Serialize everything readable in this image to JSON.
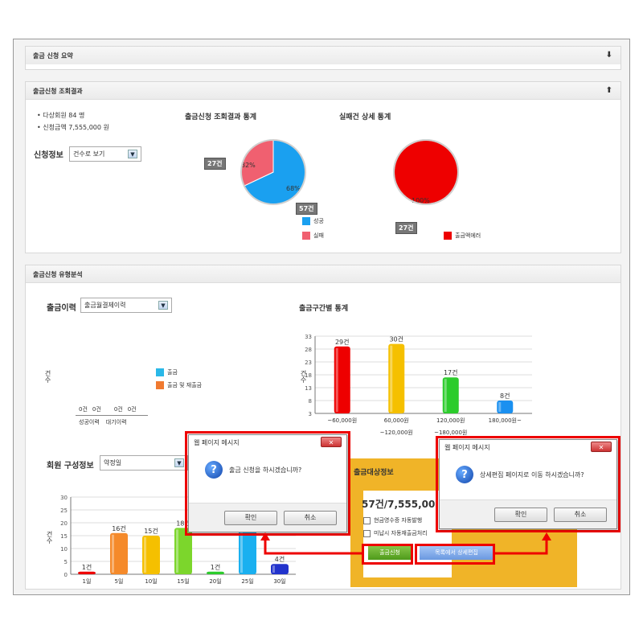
{
  "panel1": {
    "title": "출금 신청 요약",
    "toggle": "⬇"
  },
  "panel2": {
    "title": "출금신청 조회결과",
    "toggle": "⬆",
    "bullets": [
      "다상회원 84 명",
      "신청금액 7,555,000 원"
    ],
    "info_label": "신청정보",
    "info_select": "건수로 보기",
    "chart1_title": "출금신청 조회결과 통계",
    "chart2_title": "실패건 상세 통계"
  },
  "panel3": {
    "title": "출금신청 유형분석",
    "history_label": "출금이력",
    "history_select": "출금월결제이력",
    "yaxis_label": "건수",
    "legend_a": "출금",
    "legend_b": "출금 및 재출금",
    "small_values": [
      "0건",
      "0건",
      "0건",
      "0건"
    ],
    "small_cats": [
      "성공이력",
      "대기이력"
    ],
    "range_title": "출금구간별 통계",
    "member_label": "회원 구성정보",
    "member_select": "약정일",
    "target_title": "출금대상정보",
    "target_amount": "57건/7,555,00",
    "check1": "현금영수증 자동발행",
    "check2": "미납시 자동재출금처리",
    "btn_apply": "출금신청",
    "btn_edit": "목록에서 상세편집"
  },
  "dialog1": {
    "title": "웹 페이지 메시지",
    "close": "✕",
    "icon": "?",
    "message": "출금 신청을 하시겠습니까?",
    "ok": "확인",
    "cancel": "취소"
  },
  "dialog2": {
    "title": "웹 페이지 메시지",
    "close": "✕",
    "icon": "?",
    "message": "상세편집 페이지로 이동 하시겠습니까?",
    "ok": "확인",
    "cancel": "취소"
  },
  "colors": {
    "success": "#1aa0f0",
    "fail": "#f06070",
    "error": "#ee0000",
    "accent": "#f0b428",
    "red": "#e00000"
  },
  "chart_data": [
    {
      "type": "pie",
      "title": "출금신청 조회결과 통계",
      "slices": [
        {
          "name": "성공",
          "value": 68,
          "count": "57건",
          "label": "68%"
        },
        {
          "name": "실패",
          "value": 32,
          "count": "27건",
          "label": "32%"
        }
      ]
    },
    {
      "type": "pie",
      "title": "실패건 상세 통계",
      "slices": [
        {
          "name": "출금액에러",
          "value": 100,
          "count": "27건",
          "label": "100%"
        }
      ]
    },
    {
      "type": "bar",
      "title": "출금구간별 통계",
      "categories": [
        "~60,000원",
        "60,000원",
        "120,000원",
        "180,000원~"
      ],
      "cat_sub": [
        "",
        "~120,000원",
        "~180,000원",
        ""
      ],
      "values": [
        29,
        30,
        17,
        8
      ],
      "labels": [
        "29건",
        "30건",
        "17건",
        "8건"
      ],
      "colors": [
        "#e00",
        "#f5c000",
        "#2ccc2c",
        "#1a90f0"
      ],
      "yticks": [
        3,
        8,
        13,
        18,
        23,
        28,
        33
      ],
      "ylim": [
        3,
        33
      ]
    },
    {
      "type": "bar",
      "title": "회원 구성정보",
      "categories": [
        "1일",
        "5일",
        "10일",
        "15일",
        "20일",
        "25일",
        "30일"
      ],
      "values": [
        1,
        16,
        15,
        18,
        1,
        18,
        4
      ],
      "labels": [
        "1건",
        "16건",
        "15건",
        "18건",
        "1건",
        "",
        "4건"
      ],
      "colors": [
        "#e00",
        "#f58a2a",
        "#f5c000",
        "#7cd62c",
        "#2ccc2c",
        "#1ab0f0",
        "#2233cc"
      ],
      "yticks": [
        0,
        5,
        10,
        15,
        20,
        25,
        30
      ],
      "ylim": [
        0,
        30
      ]
    }
  ]
}
